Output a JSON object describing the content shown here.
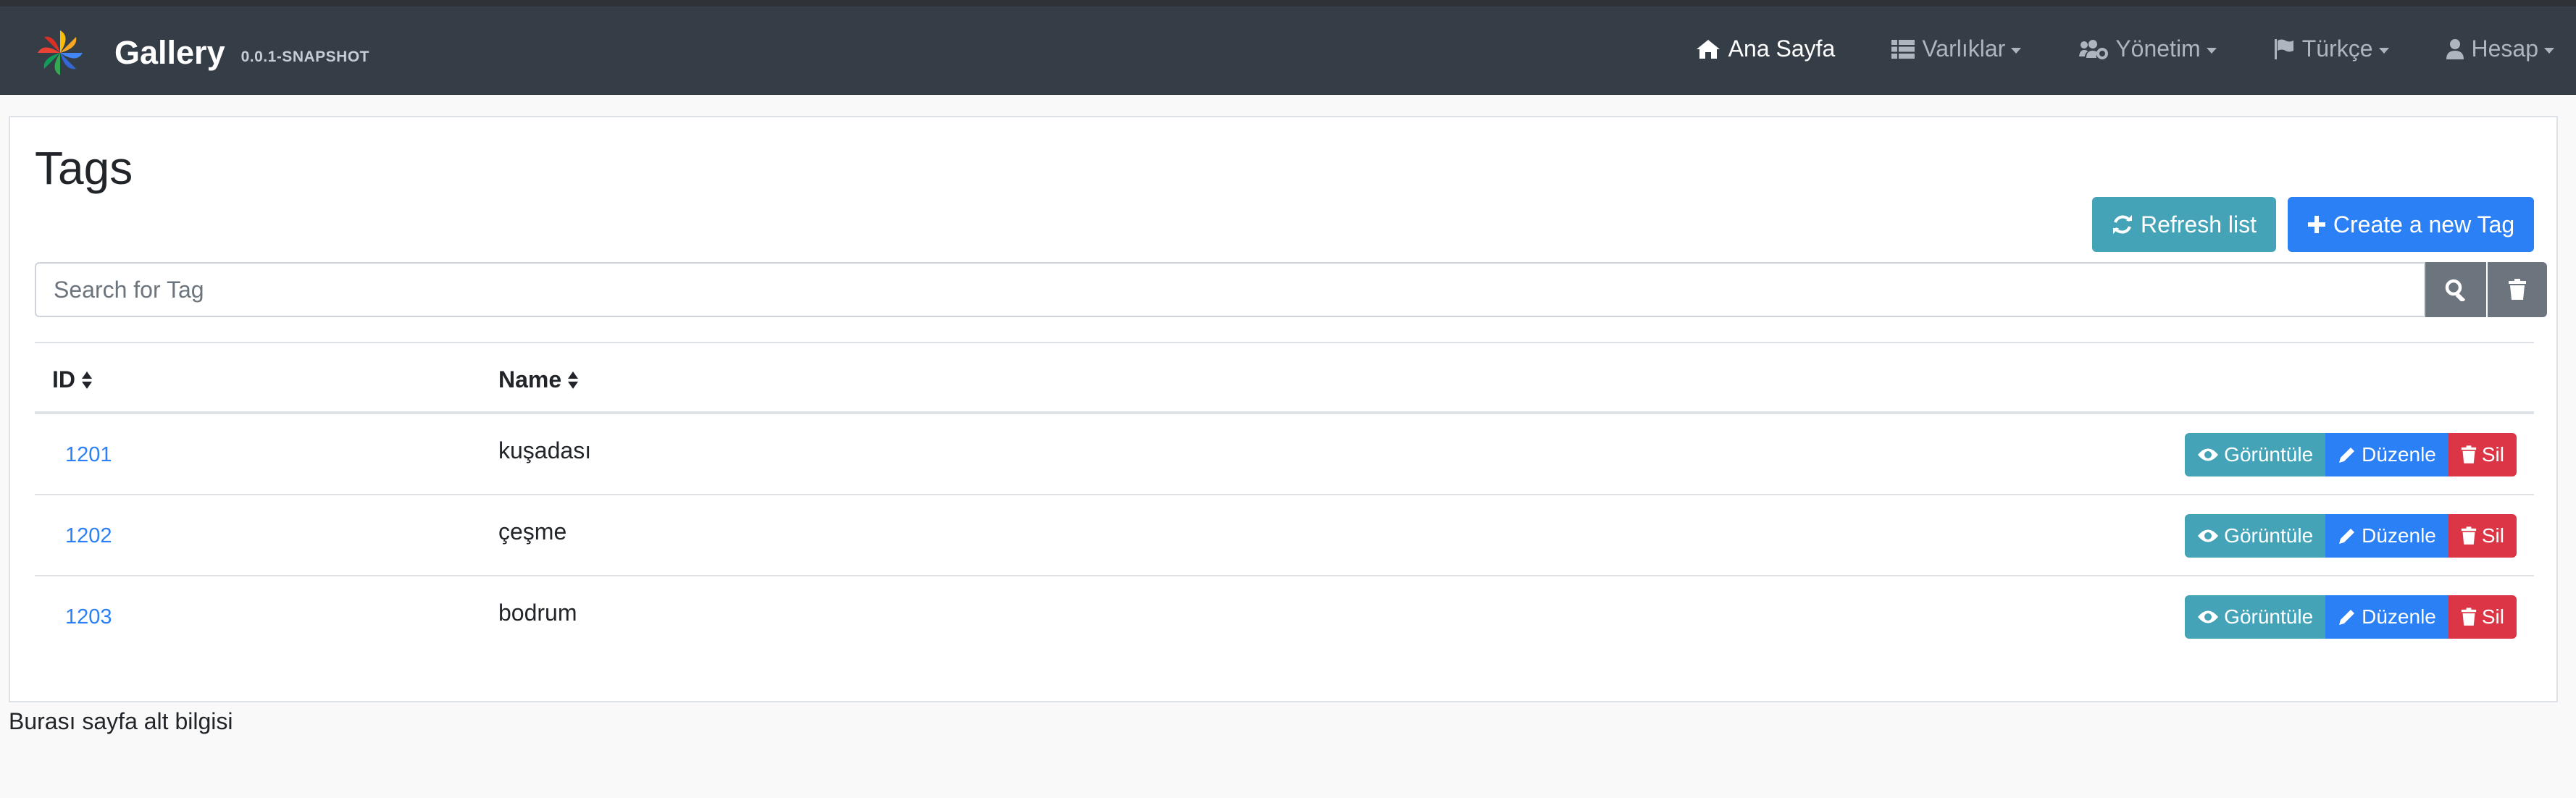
{
  "brand": {
    "title": "Gallery",
    "version": "0.0.1-SNAPSHOT"
  },
  "nav": {
    "home": "Ana Sayfa",
    "entities": "Varlıklar",
    "admin": "Yönetim",
    "language": "Türkçe",
    "account": "Hesap"
  },
  "page": {
    "title": "Tags",
    "refresh_label": "Refresh list",
    "create_label": "Create a new Tag",
    "search_placeholder": "Search for Tag"
  },
  "table": {
    "columns": [
      "ID",
      "Name"
    ],
    "rows": [
      {
        "id": "1201",
        "name": "kuşadası"
      },
      {
        "id": "1202",
        "name": "çeşme"
      },
      {
        "id": "1203",
        "name": "bodrum"
      }
    ],
    "actions": {
      "view": "Görüntüle",
      "edit": "Düzenle",
      "delete": "Sil"
    }
  },
  "footer": {
    "text": "Burası sayfa alt bilgisi"
  },
  "colors": {
    "navbar": "#353d47",
    "info": "#45a3b8",
    "primary": "#2b80f5",
    "danger": "#dc3545",
    "secondary": "#6c757d"
  }
}
